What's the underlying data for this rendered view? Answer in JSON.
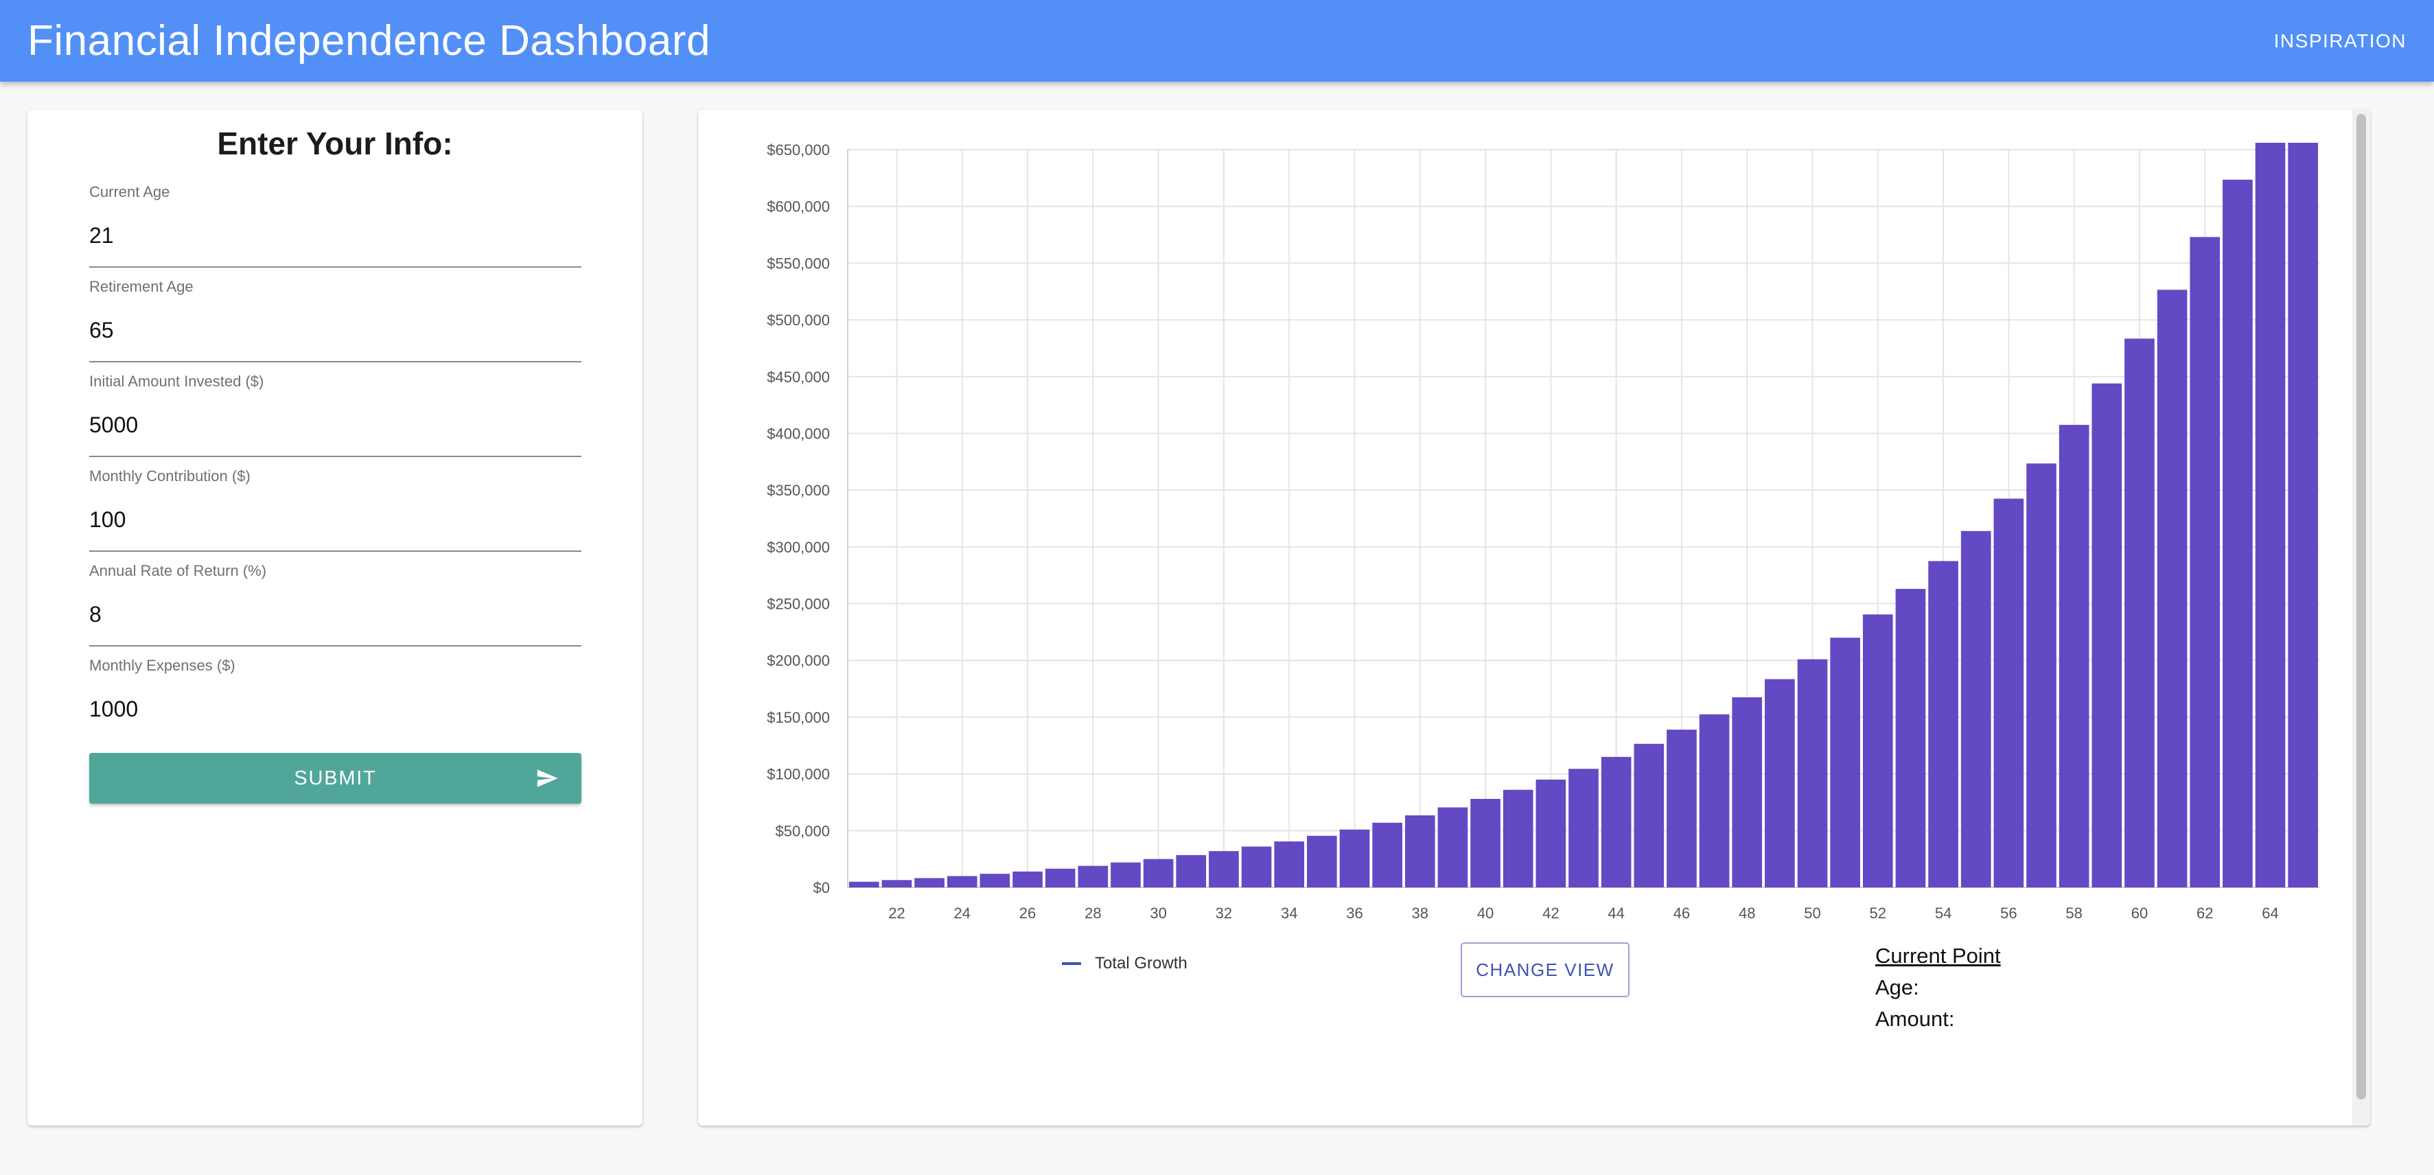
{
  "header": {
    "title": "Financial Independence Dashboard",
    "nav_link": "INSPIRATION"
  },
  "form": {
    "title": "Enter Your Info:",
    "fields": [
      {
        "label": "Current Age",
        "value": "21"
      },
      {
        "label": "Retirement Age",
        "value": "65"
      },
      {
        "label": "Initial Amount Invested ($)",
        "value": "5000"
      },
      {
        "label": "Monthly Contribution ($)",
        "value": "100"
      },
      {
        "label": "Annual Rate of Return (%)",
        "value": "8"
      },
      {
        "label": "Monthly Expenses ($)",
        "value": "1000"
      }
    ],
    "submit_label": "SUBMIT",
    "submit_icon": "send-icon"
  },
  "chart_controls": {
    "legend_label": "Total Growth",
    "legend_color": "#3f51b5",
    "change_view_label": "CHANGE VIEW"
  },
  "current_point": {
    "title": "Current Point",
    "age_label": "Age:",
    "amount_label": "Amount:"
  },
  "colors": {
    "appbar": "#5290f7",
    "submit_button": "#51a69a",
    "bar_fill": "#6349c3",
    "accent": "#3f51b5"
  },
  "chart_data": {
    "type": "bar",
    "x": [
      21,
      22,
      23,
      24,
      25,
      26,
      27,
      28,
      29,
      30,
      31,
      32,
      33,
      34,
      35,
      36,
      37,
      38,
      39,
      40,
      41,
      42,
      43,
      44,
      45,
      46,
      47,
      48,
      49,
      50,
      51,
      52,
      53,
      54,
      55,
      56,
      57,
      58,
      59,
      60,
      61,
      62,
      63,
      64,
      65
    ],
    "x_ticks": [
      22,
      24,
      26,
      28,
      30,
      32,
      34,
      36,
      38,
      40,
      42,
      44,
      46,
      48,
      50,
      52,
      54,
      56,
      58,
      60,
      62,
      64
    ],
    "series": [
      {
        "name": "Total Growth",
        "values": [
          5000,
          6500,
          8200,
          10000,
          12000,
          14000,
          16500,
          19000,
          22000,
          25000,
          28500,
          32000,
          36000,
          40500,
          45500,
          51000,
          57000,
          63500,
          70500,
          78000,
          86000,
          95000,
          104500,
          115000,
          126500,
          139000,
          152500,
          167500,
          183500,
          201000,
          220000,
          240500,
          263000,
          287500,
          314000,
          342500,
          373500,
          407500,
          444000,
          483500,
          526500,
          573000,
          623500,
          678000,
          737000
        ]
      }
    ],
    "ylim": [
      0,
      650000
    ],
    "y_ticks": [
      "$0",
      "$50,000",
      "$100,000",
      "$150,000",
      "$200,000",
      "$250,000",
      "$300,000",
      "$350,000",
      "$400,000",
      "$450,000",
      "$500,000",
      "$550,000",
      "$600,000",
      "$650,000"
    ],
    "y_tick_values": [
      0,
      50000,
      100000,
      150000,
      200000,
      250000,
      300000,
      350000,
      400000,
      450000,
      500000,
      550000,
      600000,
      650000
    ],
    "title": "",
    "xlabel": "",
    "ylabel": "",
    "grid": true
  }
}
